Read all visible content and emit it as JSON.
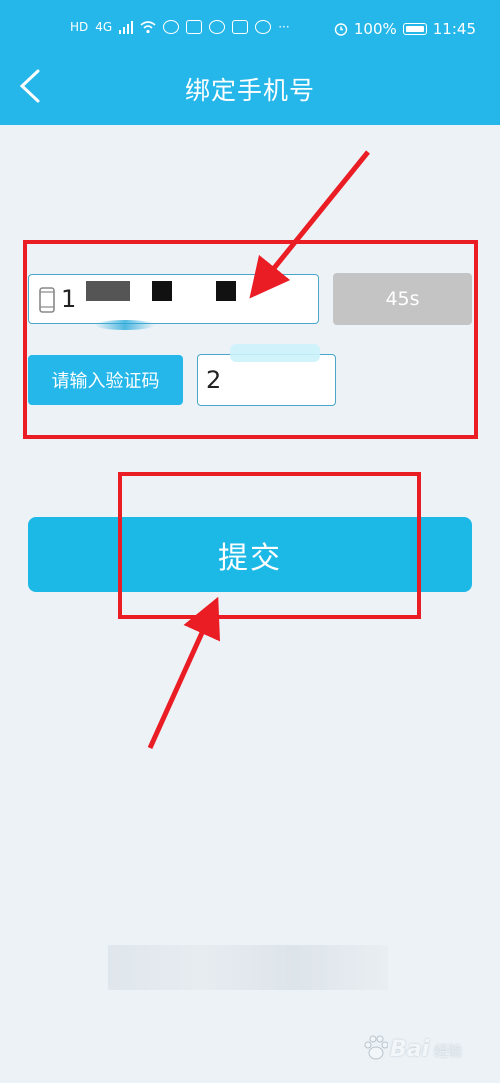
{
  "status_bar": {
    "network_text": "HD",
    "signal_text": "4G",
    "battery_text": "100%",
    "time_text": "11:45"
  },
  "header": {
    "title": "绑定手机号",
    "background_color": "#25b7e9"
  },
  "form": {
    "phone_value": "1",
    "countdown_label": "45s",
    "request_code_label": "请输入验证码",
    "code_value": "2",
    "submit_label": "提交"
  },
  "watermark": {
    "brand_text": "Bai",
    "sub_text": "经验"
  },
  "colors": {
    "accent": "#1db9e6",
    "highlight_red": "#ea1c24",
    "disabled_grey": "#c4c4c4"
  }
}
